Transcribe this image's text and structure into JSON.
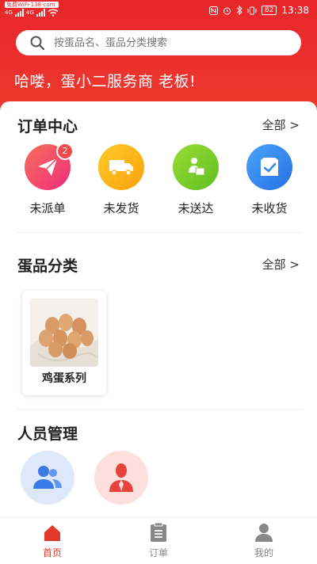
{
  "status_bar": {
    "carrier_tag": "免费WiFi-138-com",
    "network_1": "4G",
    "network_2": "4G",
    "battery": "82",
    "time": "13:38"
  },
  "search": {
    "placeholder": "按蛋品名、蛋品分类搜索",
    "icon": "search-icon"
  },
  "greeting": "哈喽，蛋小二服务商 老板!",
  "orders": {
    "title": "订单中心",
    "more": "全部 >",
    "items": [
      {
        "label": "未派单",
        "icon": "paper-plane-icon",
        "badge": "2",
        "color": "#f2456a"
      },
      {
        "label": "未发货",
        "icon": "truck-icon",
        "badge": "",
        "color": "#fdb31a"
      },
      {
        "label": "未送达",
        "icon": "delivery-person-icon",
        "badge": "",
        "color": "#7acc2a"
      },
      {
        "label": "未收货",
        "icon": "checked-box-icon",
        "badge": "",
        "color": "#2f88f0"
      }
    ]
  },
  "categories": {
    "title": "蛋品分类",
    "more": "全部 >",
    "items": [
      {
        "label": "鸡蛋系列",
        "image": "eggs-image"
      }
    ]
  },
  "staff": {
    "title": "人员管理",
    "items": [
      {
        "icon": "users-icon",
        "color": "#dde8fb"
      },
      {
        "icon": "staff-person-icon",
        "color": "#fde0de"
      }
    ]
  },
  "tabbar": {
    "items": [
      {
        "label": "首页",
        "icon": "home-icon",
        "active": true
      },
      {
        "label": "订单",
        "icon": "clipboard-icon",
        "active": false
      },
      {
        "label": "我的",
        "icon": "user-icon",
        "active": false
      }
    ]
  },
  "colors": {
    "brand_red": "#e8262a",
    "active_tab": "#e23a2a",
    "inactive_tab": "#888888"
  }
}
